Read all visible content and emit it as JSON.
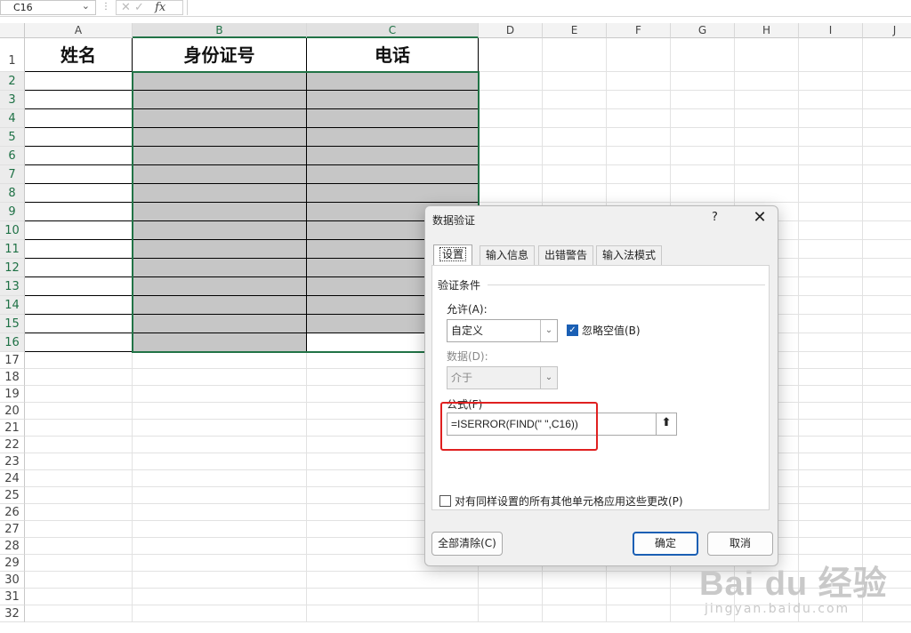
{
  "formula_bar": {
    "name_box": "C16",
    "name_box_dropdown_icon": "chevron-down-icon",
    "fx_label": "fx",
    "formula": ""
  },
  "sheet": {
    "columns": [
      "A",
      "B",
      "C",
      "D",
      "E",
      "F",
      "G",
      "H",
      "I",
      "J"
    ],
    "rows": [
      "1",
      "2",
      "3",
      "4",
      "5",
      "6",
      "7",
      "8",
      "9",
      "10",
      "11",
      "12",
      "13",
      "14",
      "15",
      "16",
      "17",
      "18",
      "19",
      "20",
      "21",
      "22",
      "23",
      "24",
      "25",
      "26",
      "27",
      "28",
      "29",
      "30",
      "31",
      "32"
    ],
    "selected_columns": [
      "B",
      "C"
    ],
    "selected_rows_range": [
      2,
      16
    ],
    "table_headers": {
      "A1": "姓名",
      "B1": "身份证号",
      "C1": "电话"
    },
    "colors": {
      "selection": "#217346",
      "gray_fill": "#c6c6c6"
    }
  },
  "dialog": {
    "title": "数据验证",
    "help": "?",
    "close": "✕",
    "tabs": [
      {
        "label": "设置",
        "active": true
      },
      {
        "label": "输入信息",
        "active": false
      },
      {
        "label": "出错警告",
        "active": false
      },
      {
        "label": "输入法模式",
        "active": false
      }
    ],
    "group_title": "验证条件",
    "allow_label": "允许(A):",
    "allow_value": "自定义",
    "ignore_blank_label": "忽略空值(B)",
    "ignore_blank_checked": true,
    "data_label": "数据(D):",
    "data_value": "介于",
    "formula_label": "公式(F)",
    "formula_value": "=ISERROR(FIND(\" \",C16))",
    "apply_all_label": "对有同样设置的所有其他单元格应用这些更改(P)",
    "apply_all_checked": false,
    "clear_all_button": "全部清除(C)",
    "ok_button": "确定",
    "cancel_button": "取消",
    "highlight_color": "#e02020"
  },
  "watermark": {
    "brand": "Bai du 经验",
    "url": "jingyan.baidu.com"
  }
}
